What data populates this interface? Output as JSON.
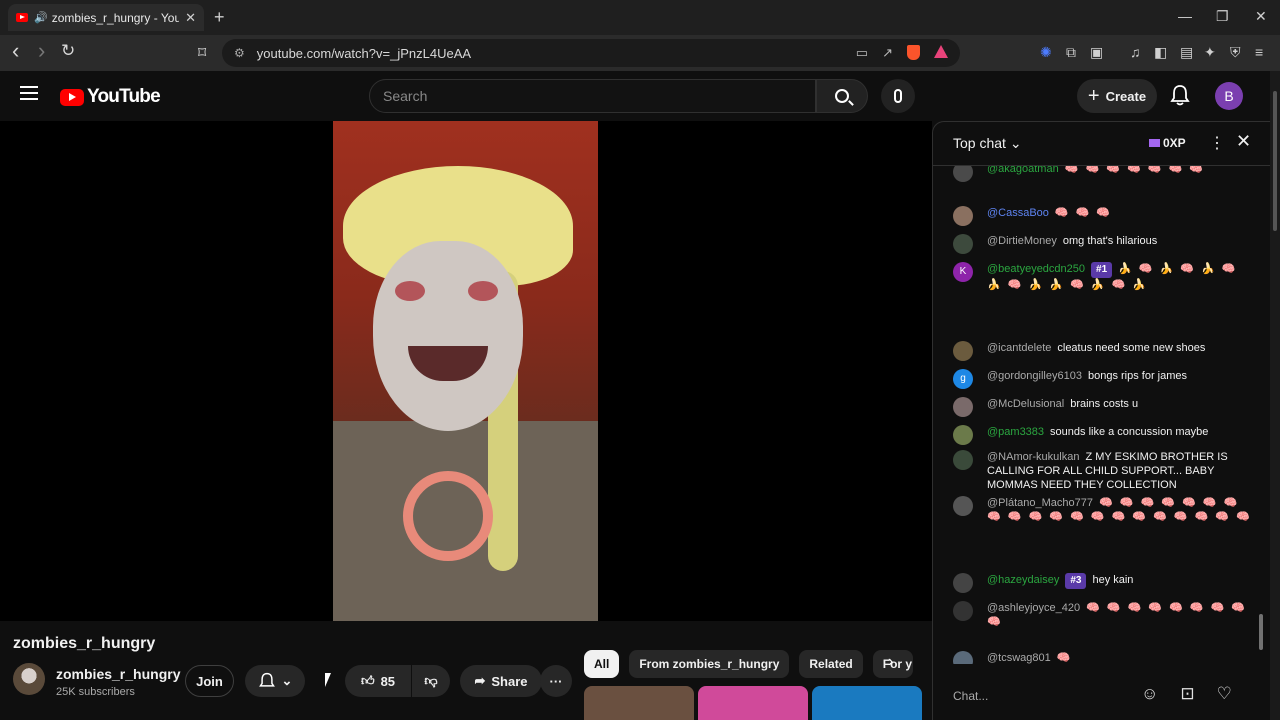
{
  "browser": {
    "tab_title": "zombies_r_hungry - YouTube",
    "tab_close": "✕",
    "new_tab": "+",
    "url": "youtube.com/watch?v=_jPnzL4UeAA",
    "back": "‹",
    "forward": "›",
    "reload": "↻",
    "bookmark": "⌑",
    "minimize": "—",
    "maximize": "❐",
    "close": "✕"
  },
  "header": {
    "logo_text": "YouTube",
    "search_placeholder": "Search",
    "create_label": "Create",
    "avatar_letter": "B"
  },
  "video": {
    "title": "zombies_r_hungry",
    "channel_name": "zombies_r_hungry",
    "subscribers": "25K subscribers",
    "join_label": "Join",
    "likes": "85",
    "share_label": "Share",
    "more": "···"
  },
  "chips": [
    {
      "label": "All",
      "active": true
    },
    {
      "label": "From zombies_r_hungry",
      "active": false
    },
    {
      "label": "Related",
      "active": false
    },
    {
      "label": "For y",
      "active": false
    }
  ],
  "chat": {
    "title": "Top chat",
    "xp": "0XP",
    "input_placeholder": "Chat...",
    "messages": [
      {
        "author": "@akagoatman",
        "text": "",
        "emoji": "🧠 🧠 🧠 🧠 🧠 🧠 🧠",
        "badge": "",
        "author_color": "#2ba640",
        "avatar_color": "#4a4a4a",
        "avatar_letter": ""
      },
      {
        "author": "@CassaBoo",
        "text": "",
        "emoji": "🧠 🧠 🧠",
        "badge": "",
        "author_color": "#5e84f1",
        "avatar_color": "#8a7060",
        "avatar_letter": ""
      },
      {
        "author": "@DirtieMoney",
        "text": "omg that's hilarious",
        "emoji": "",
        "badge": "",
        "author_color": "#aaaaaa",
        "avatar_color": "#3d4a3d",
        "avatar_letter": ""
      },
      {
        "author": "@beatyeyedcdn250",
        "text": "",
        "emoji": "🍌 🧠 🍌 🧠 🍌 🧠 🍌 🧠 🍌 🍌 🧠 🍌 🧠 🍌",
        "badge": "#1",
        "author_color": "#2ba640",
        "avatar_color": "#8e24aa",
        "avatar_letter": "K"
      },
      {
        "author": "@icantdelete",
        "text": "cleatus need some new shoes",
        "emoji": "",
        "badge": "",
        "author_color": "#aaaaaa",
        "avatar_color": "#6b5b3e",
        "avatar_letter": ""
      },
      {
        "author": "@gordongilley6103",
        "text": "bongs rips for james",
        "emoji": "",
        "badge": "",
        "author_color": "#aaaaaa",
        "avatar_color": "#1e88e5",
        "avatar_letter": "g"
      },
      {
        "author": "@McDelusional",
        "text": "brains costs u",
        "emoji": "",
        "badge": "",
        "author_color": "#aaaaaa",
        "avatar_color": "#7a6a6a",
        "avatar_letter": ""
      },
      {
        "author": "@pam3383",
        "text": "sounds like a concussion maybe",
        "emoji": "",
        "badge": "",
        "author_color": "#2ba640",
        "avatar_color": "#6b7a4a",
        "avatar_letter": ""
      },
      {
        "author": "@NAmor-kukulkan",
        "text": "Z MY ESKIMO BROTHER IS CALLING FOR ALL CHILD SUPPORT... BABY MOMMAS NEED THEY COLLECTION",
        "emoji": "",
        "badge": "",
        "author_color": "#aaaaaa",
        "avatar_color": "#3a4a3a",
        "avatar_letter": ""
      },
      {
        "author": "@Plátano_Macho777",
        "text": "",
        "emoji": "🧠 🧠 🧠 🧠 🧠 🧠 🧠 🧠 🧠 🧠 🧠 🧠 🧠 🧠 🧠 🧠 🧠 🧠 🧠 🧠",
        "badge": "",
        "author_color": "#aaaaaa",
        "avatar_color": "#555555",
        "avatar_letter": ""
      },
      {
        "author": "@hazeydaisey",
        "text": "hey kain",
        "emoji": "",
        "badge": "#3",
        "author_color": "#2ba640",
        "avatar_color": "#444444",
        "avatar_letter": ""
      },
      {
        "author": "@ashleyjoyce_420",
        "text": "",
        "emoji": "🧠 🧠 🧠 🧠 🧠 🧠 🧠 🧠 🧠",
        "badge": "",
        "author_color": "#aaaaaa",
        "avatar_color": "#333333",
        "avatar_letter": ""
      },
      {
        "author": "@tcswag801",
        "text": "",
        "emoji": "🧠",
        "badge": "",
        "author_color": "#aaaaaa",
        "avatar_color": "#5a6a7a",
        "avatar_letter": ""
      }
    ]
  }
}
